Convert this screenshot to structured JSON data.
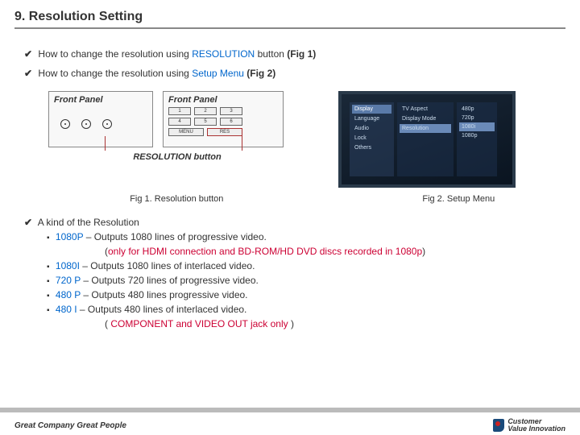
{
  "header": {
    "title": "9. Resolution Setting"
  },
  "lines": {
    "l1_pre": "How to change the resolution using ",
    "l1_kw": "RESOLUTION",
    "l1_post": " button ",
    "l1_fig": "(Fig 1)",
    "l2_pre": "How to change the resolution using ",
    "l2_kw": "Setup Menu",
    "l2_post": " ",
    "l2_fig": "(Fig 2)"
  },
  "panels": {
    "label": "Front Panel",
    "res_button_label": "RESOLUTION button",
    "btns": [
      "1",
      "2",
      "3",
      "4",
      "5",
      "6",
      "MENU",
      "RES"
    ]
  },
  "tv": {
    "left": [
      "Display",
      "Language",
      "Audio",
      "Lock",
      "Others"
    ],
    "mid": [
      "TV Aspect",
      "Display Mode",
      "Resolution"
    ],
    "right": [
      "480p",
      "720p",
      "1080i",
      "1080p"
    ]
  },
  "captions": {
    "c1": "Fig 1. Resolution button",
    "c2": "Fig 2. Setup Menu"
  },
  "resolutions": {
    "heading": "A kind of the Resolution",
    "i1_name": "1080P",
    "i1_desc": " – Outputs 1080 lines of progressive video.",
    "i1_note_open": "(",
    "i1_note": "only for HDMI connection and BD-ROM/HD DVD discs recorded in 1080p",
    "i1_note_close": ")",
    "i2_name": "1080I",
    "i2_desc": " – Outputs 1080 lines of interlaced video.",
    "i3_name": "720 P",
    "i3_desc": " – Outputs 720 lines of progressive video.",
    "i4_name": "480 P",
    "i4_desc": " – Outputs 480 lines progressive video.",
    "i5_name": "480 I ",
    "i5_desc": " – Outputs 480 lines of interlaced video.",
    "i5_note_open": "( ",
    "i5_note": "COMPONENT and VIDEO OUT jack only",
    "i5_note_close": " )"
  },
  "footer": {
    "tagline": "Great Company Great People",
    "logo_l1": "Customer",
    "logo_l2": "Value Innovation"
  }
}
